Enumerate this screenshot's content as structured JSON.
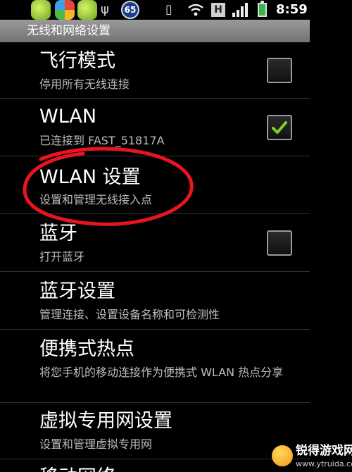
{
  "status_bar": {
    "time": "8:59",
    "notification_count": "65",
    "network_type": "H",
    "icons": [
      "app-icon",
      "app-icon",
      "app-icon",
      "usb-icon",
      "vibrate-icon",
      "wifi-icon",
      "signal-icon",
      "battery-icon"
    ]
  },
  "title_bar": {
    "title": "无线和网络设置"
  },
  "settings": [
    {
      "title": "飞行模式",
      "subtitle": "停用所有无线连接",
      "has_checkbox": true,
      "checked": false
    },
    {
      "title": "WLAN",
      "subtitle": "已连接到 FAST_51817A",
      "has_checkbox": true,
      "checked": true
    },
    {
      "title": "WLAN 设置",
      "subtitle": "设置和管理无线接入点",
      "has_checkbox": false,
      "highlighted": true
    },
    {
      "title": "蓝牙",
      "subtitle": "打开蓝牙",
      "has_checkbox": true,
      "checked": false
    },
    {
      "title": "蓝牙设置",
      "subtitle": "管理连接、设置设备名称和可检测性",
      "has_checkbox": false
    },
    {
      "title": "便携式热点",
      "subtitle": "将您手机的移动连接作为便携式 WLAN 热点分享",
      "has_checkbox": false
    },
    {
      "title": "虚拟专用网设置",
      "subtitle": "设置和管理虚拟专用网",
      "has_checkbox": false
    },
    {
      "title": "移动网络",
      "subtitle": "",
      "has_checkbox": false
    }
  ],
  "colors": {
    "annotation": "#e8141e",
    "check_green": "#7ed321",
    "title_bar": "#858585"
  },
  "watermark": {
    "title": "锐得游戏网",
    "url": "www.ytruida.com"
  }
}
